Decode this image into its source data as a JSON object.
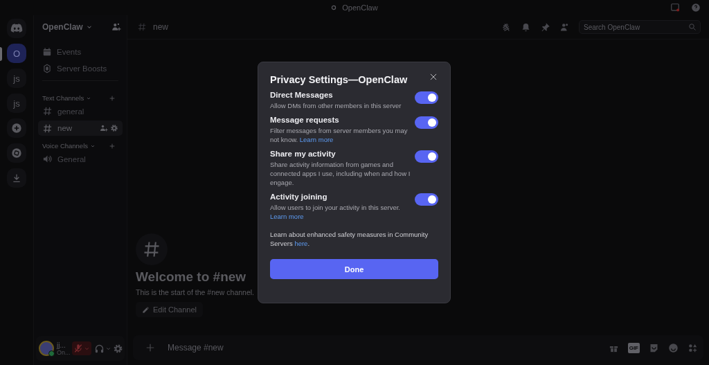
{
  "title_bar": {
    "title": "OpenClaw"
  },
  "servers": [
    {
      "kind": "logo",
      "selected": false
    },
    {
      "kind": "text",
      "label": "O",
      "selected": true
    },
    {
      "kind": "text",
      "label": "js",
      "selected": false
    },
    {
      "kind": "text",
      "label": "js",
      "selected": false
    },
    {
      "kind": "add",
      "selected": false
    },
    {
      "kind": "discover",
      "selected": false
    },
    {
      "kind": "download",
      "selected": false
    }
  ],
  "sidebar": {
    "server_name": "OpenClaw",
    "top_items": [
      {
        "kind": "events",
        "label": "Events"
      },
      {
        "kind": "boosts",
        "label": "Server Boosts"
      }
    ],
    "categories": [
      {
        "label": "Text Channels",
        "channels": [
          {
            "kind": "text",
            "label": "general",
            "selected": false
          },
          {
            "kind": "text",
            "label": "new",
            "selected": true
          }
        ]
      },
      {
        "label": "Voice Channels",
        "channels": [
          {
            "kind": "voice",
            "label": "General",
            "selected": false
          }
        ]
      }
    ],
    "user": {
      "name": "jj...",
      "status": "On...",
      "muted": true
    }
  },
  "header": {
    "channel": "new",
    "search": {
      "placeholder": "Search OpenClaw"
    }
  },
  "welcome": {
    "heading": "Welcome to #new",
    "subtitle": "This is the start of the #new channel.",
    "edit_button": "Edit Channel"
  },
  "composer": {
    "placeholder": "Message #new",
    "gif_label": "GIF"
  },
  "modal": {
    "title": "Privacy Settings—OpenClaw",
    "settings": [
      {
        "label": "Direct Messages",
        "description": "Allow DMs from other members in this server",
        "on": true
      },
      {
        "label": "Message requests",
        "description": "Filter messages from server members you may not know.",
        "link": "Learn more",
        "on": true
      },
      {
        "label": "Share my activity",
        "description": "Share activity information from games and connected apps I use, including when and how I engage.",
        "on": true
      },
      {
        "label": "Activity joining",
        "description": "Allow users to join your activity in this server.",
        "link": "Learn more",
        "on": true
      }
    ],
    "note": {
      "before": "Learn about enhanced safety measures in Community Servers",
      "link": "here",
      "after": "."
    },
    "done_button": "Done"
  }
}
